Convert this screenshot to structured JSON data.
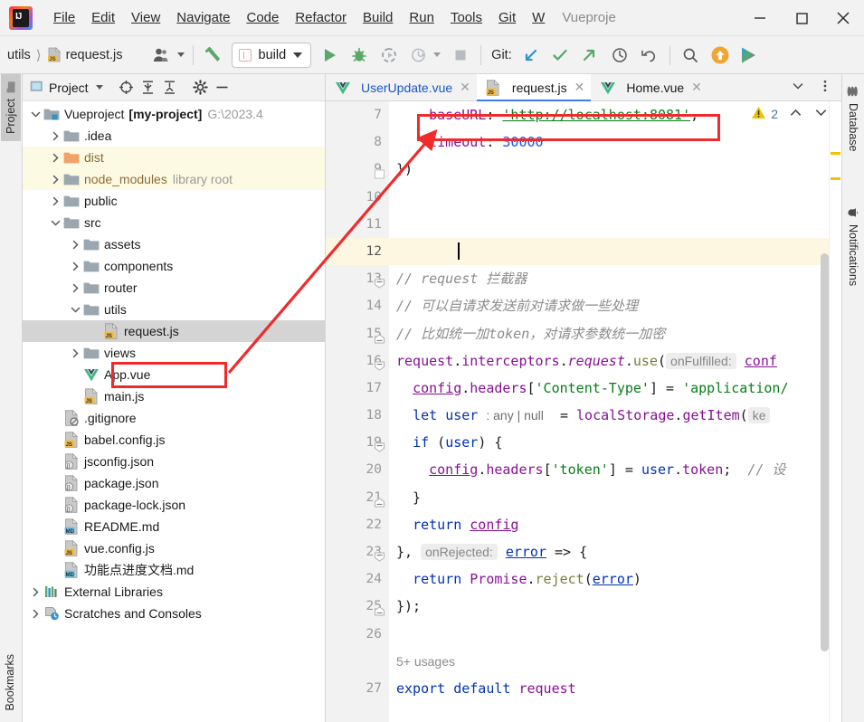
{
  "window": {
    "title": "Vueproje",
    "app_icon": "intellij-idea-logo"
  },
  "menu": {
    "items": [
      {
        "label": "File",
        "mnemonic": "F"
      },
      {
        "label": "Edit",
        "mnemonic": "E"
      },
      {
        "label": "View",
        "mnemonic": "V"
      },
      {
        "label": "Navigate",
        "mnemonic": "N"
      },
      {
        "label": "Code",
        "mnemonic": "C"
      },
      {
        "label": "Refactor",
        "mnemonic": "R"
      },
      {
        "label": "Build",
        "mnemonic": "B"
      },
      {
        "label": "Run",
        "mnemonic": "u"
      },
      {
        "label": "Tools",
        "mnemonic": "T"
      },
      {
        "label": "Git",
        "mnemonic": "G"
      },
      {
        "label": "W",
        "mnemonic": "W"
      }
    ],
    "minimize": "minimize-window",
    "maximize": "maximize-window",
    "close": "close-window"
  },
  "toolbar": {
    "breadcrumb": [
      "utils",
      "request.js"
    ],
    "breadcrumb_file_icon": "js-file-icon",
    "avatar_label": "user-account",
    "build_hammer": "build-hammer-icon",
    "run_config": "build",
    "run": "run-button",
    "debug": "debug-button",
    "coverage": "run-with-coverage-button",
    "profiler": "profiler-button",
    "stop": "stop-button",
    "git_label": "Git:",
    "git_update": "git-update-project",
    "git_commit": "git-commit",
    "git_push": "git-push",
    "git_history": "git-history",
    "git_rollback": "git-rollback",
    "search": "search-everywhere",
    "update_app": "ide-update-available",
    "ide_run": "ide-extra-run"
  },
  "left_stripe": {
    "project": "Project",
    "bookmarks": "Bookmarks"
  },
  "right_stripe": {
    "database": "Database",
    "notifications": "Notifications"
  },
  "project_panel": {
    "title": "Project",
    "buttons": [
      "select-opened-file",
      "expand-all",
      "collapse-all",
      "settings",
      "hide"
    ],
    "tree": [
      {
        "indent": 0,
        "arrow": "down",
        "icon": "module-folder-icon",
        "label": "Vueproject",
        "bold": "[my-project]",
        "muted": "G:\\2023.4",
        "state": "normal"
      },
      {
        "indent": 1,
        "arrow": "right",
        "icon": "folder-icon",
        "label": ".idea",
        "state": "normal"
      },
      {
        "indent": 1,
        "arrow": "right",
        "icon": "excluded-folder-icon",
        "label": "dist",
        "state": "yellow"
      },
      {
        "indent": 1,
        "arrow": "right",
        "icon": "folder-icon",
        "label": "node_modules",
        "muted": "library root",
        "state": "yellow"
      },
      {
        "indent": 1,
        "arrow": "right",
        "icon": "folder-icon",
        "label": "public",
        "state": "normal"
      },
      {
        "indent": 1,
        "arrow": "down",
        "icon": "folder-icon",
        "label": "src",
        "state": "normal"
      },
      {
        "indent": 2,
        "arrow": "right",
        "icon": "folder-icon",
        "label": "assets",
        "state": "normal"
      },
      {
        "indent": 2,
        "arrow": "right",
        "icon": "folder-icon",
        "label": "components",
        "state": "normal"
      },
      {
        "indent": 2,
        "arrow": "right",
        "icon": "folder-icon",
        "label": "router",
        "state": "normal"
      },
      {
        "indent": 2,
        "arrow": "down",
        "icon": "folder-icon",
        "label": "utils",
        "state": "normal"
      },
      {
        "indent": 3,
        "arrow": "none",
        "icon": "js-file-icon",
        "label": "request.js",
        "state": "selected"
      },
      {
        "indent": 2,
        "arrow": "right",
        "icon": "folder-icon",
        "label": "views",
        "state": "normal"
      },
      {
        "indent": 2,
        "arrow": "none",
        "icon": "vue-file-icon",
        "label": "App.vue",
        "state": "normal"
      },
      {
        "indent": 2,
        "arrow": "none",
        "icon": "js-file-icon",
        "label": "main.js",
        "state": "normal"
      },
      {
        "indent": 1,
        "arrow": "none",
        "icon": "gitignore-file-icon",
        "label": ".gitignore",
        "state": "normal"
      },
      {
        "indent": 1,
        "arrow": "none",
        "icon": "js-file-icon",
        "label": "babel.config.js",
        "state": "normal"
      },
      {
        "indent": 1,
        "arrow": "none",
        "icon": "json-file-icon",
        "label": "jsconfig.json",
        "state": "normal"
      },
      {
        "indent": 1,
        "arrow": "none",
        "icon": "json-file-icon",
        "label": "package.json",
        "state": "normal"
      },
      {
        "indent": 1,
        "arrow": "none",
        "icon": "json-file-icon",
        "label": "package-lock.json",
        "state": "normal"
      },
      {
        "indent": 1,
        "arrow": "none",
        "icon": "md-file-icon",
        "label": "README.md",
        "state": "normal"
      },
      {
        "indent": 1,
        "arrow": "none",
        "icon": "js-file-icon",
        "label": "vue.config.js",
        "state": "normal"
      },
      {
        "indent": 1,
        "arrow": "none",
        "icon": "md-file-icon",
        "label": "功能点进度文档.md",
        "state": "normal"
      },
      {
        "indent": 0,
        "arrow": "right",
        "icon": "external-libraries-icon",
        "label": "External Libraries",
        "state": "normal"
      },
      {
        "indent": 0,
        "arrow": "right",
        "icon": "scratches-icon",
        "label": "Scratches and Consoles",
        "state": "normal"
      }
    ]
  },
  "editor": {
    "tabs": [
      {
        "label": "UserUpdate.vue",
        "icon": "vue-file-icon",
        "active": false,
        "color": "blue"
      },
      {
        "label": "request.js",
        "icon": "js-file-icon",
        "active": true,
        "color": "normal"
      },
      {
        "label": "Home.vue",
        "icon": "vue-file-icon",
        "active": false,
        "color": "normal"
      }
    ],
    "tab_list_button": "show-hidden-tabs",
    "tab_options_button": "tab-options",
    "inspection": {
      "icon": "warning-triangle-icon",
      "count": "2",
      "prev": "previous-highlight",
      "next": "next-highlight"
    },
    "first_line_number": 7,
    "caret_line": 12,
    "lines": [
      {
        "no": 7,
        "fold": "none",
        "cur": false,
        "tokens": [
          {
            "t": "    ",
            "c": "plain"
          },
          {
            "t": "baseURL",
            "c": "p"
          },
          {
            "t": ": ",
            "c": "plain"
          },
          {
            "t": "'http://localhost:8081'",
            "c": "s-u"
          },
          {
            "t": ",",
            "c": "plain"
          }
        ]
      },
      {
        "no": 8,
        "fold": "none",
        "cur": false,
        "tokens": [
          {
            "t": "    ",
            "c": "plain"
          },
          {
            "t": "timeout",
            "c": "p"
          },
          {
            "t": ": ",
            "c": "plain"
          },
          {
            "t": "30000",
            "c": "n"
          }
        ]
      },
      {
        "no": 9,
        "fold": "end",
        "cur": false,
        "tokens": [
          {
            "t": "})",
            "c": "plain"
          }
        ]
      },
      {
        "no": 10,
        "fold": "none",
        "cur": false,
        "tokens": []
      },
      {
        "no": 11,
        "fold": "none",
        "cur": false,
        "tokens": []
      },
      {
        "no": 12,
        "fold": "none",
        "cur": true,
        "tokens": [
          {
            "t": "caret",
            "c": "caret"
          }
        ]
      },
      {
        "no": 13,
        "fold": "open",
        "cur": false,
        "tokens": [
          {
            "t": "// request 拦截器",
            "c": "c"
          }
        ]
      },
      {
        "no": 14,
        "fold": "none",
        "cur": false,
        "tokens": [
          {
            "t": "// 可以自请求发送前对请求做一些处理",
            "c": "c"
          }
        ]
      },
      {
        "no": 15,
        "fold": "close",
        "cur": false,
        "tokens": [
          {
            "t": "// 比如统一加token，对请求参数统一加密",
            "c": "c"
          }
        ]
      },
      {
        "no": 16,
        "fold": "open",
        "cur": false,
        "tokens": [
          {
            "t": "request",
            "c": "p"
          },
          {
            "t": ".",
            "c": "plain"
          },
          {
            "t": "interceptors",
            "c": "p"
          },
          {
            "t": ".",
            "c": "plain"
          },
          {
            "t": "request",
            "c": "p-it"
          },
          {
            "t": ".",
            "c": "plain"
          },
          {
            "t": "use",
            "c": "m"
          },
          {
            "t": "(",
            "c": "plain"
          },
          {
            "t": "onFulfilled:",
            "c": "hint"
          },
          {
            "t": " ",
            "c": "plain"
          },
          {
            "t": "conf",
            "c": "p-u"
          }
        ]
      },
      {
        "no": 17,
        "fold": "none",
        "cur": false,
        "tokens": [
          {
            "t": "  ",
            "c": "plain"
          },
          {
            "t": "config",
            "c": "p-u"
          },
          {
            "t": ".",
            "c": "plain"
          },
          {
            "t": "headers",
            "c": "p"
          },
          {
            "t": "[",
            "c": "plain"
          },
          {
            "t": "'Content-Type'",
            "c": "s"
          },
          {
            "t": "] = ",
            "c": "plain"
          },
          {
            "t": "'application/",
            "c": "s"
          }
        ]
      },
      {
        "no": 18,
        "fold": "none",
        "cur": false,
        "tokens": [
          {
            "t": "  ",
            "c": "plain"
          },
          {
            "t": "let",
            "c": "k"
          },
          {
            "t": " ",
            "c": "plain"
          },
          {
            "t": "user",
            "c": "k"
          },
          {
            "t": " ",
            "c": "plain"
          },
          {
            "t": ": any | null",
            "c": "hint2"
          },
          {
            "t": "  = ",
            "c": "plain"
          },
          {
            "t": "localStorage",
            "c": "p"
          },
          {
            "t": ".",
            "c": "plain"
          },
          {
            "t": "getItem",
            "c": "p"
          },
          {
            "t": "(",
            "c": "plain"
          },
          {
            "t": "ke",
            "c": "hint"
          }
        ]
      },
      {
        "no": 19,
        "fold": "open",
        "cur": false,
        "tokens": [
          {
            "t": "  ",
            "c": "plain"
          },
          {
            "t": "if",
            "c": "k"
          },
          {
            "t": " (",
            "c": "plain"
          },
          {
            "t": "user",
            "c": "k"
          },
          {
            "t": ") {",
            "c": "plain"
          }
        ]
      },
      {
        "no": 20,
        "fold": "none",
        "cur": false,
        "tokens": [
          {
            "t": "    ",
            "c": "plain"
          },
          {
            "t": "config",
            "c": "p-u"
          },
          {
            "t": ".",
            "c": "plain"
          },
          {
            "t": "headers",
            "c": "p"
          },
          {
            "t": "[",
            "c": "plain"
          },
          {
            "t": "'token'",
            "c": "s"
          },
          {
            "t": "] = ",
            "c": "plain"
          },
          {
            "t": "user",
            "c": "k"
          },
          {
            "t": ".",
            "c": "plain"
          },
          {
            "t": "token",
            "c": "p"
          },
          {
            "t": ";  ",
            "c": "plain"
          },
          {
            "t": "// 设",
            "c": "c"
          }
        ]
      },
      {
        "no": 21,
        "fold": "close",
        "cur": false,
        "tokens": [
          {
            "t": "  }",
            "c": "plain"
          }
        ]
      },
      {
        "no": 22,
        "fold": "none",
        "cur": false,
        "tokens": [
          {
            "t": "  ",
            "c": "plain"
          },
          {
            "t": "return",
            "c": "k"
          },
          {
            "t": " ",
            "c": "plain"
          },
          {
            "t": "config",
            "c": "p-u"
          }
        ]
      },
      {
        "no": 23,
        "fold": "open",
        "cur": false,
        "tokens": [
          {
            "t": "}, ",
            "c": "plain"
          },
          {
            "t": "onRejected:",
            "c": "hint"
          },
          {
            "t": " ",
            "c": "plain"
          },
          {
            "t": "error",
            "c": "k-u"
          },
          {
            "t": " => {",
            "c": "plain"
          }
        ]
      },
      {
        "no": 24,
        "fold": "none",
        "cur": false,
        "tokens": [
          {
            "t": "  ",
            "c": "plain"
          },
          {
            "t": "return",
            "c": "k"
          },
          {
            "t": " ",
            "c": "plain"
          },
          {
            "t": "Promise",
            "c": "p"
          },
          {
            "t": ".",
            "c": "plain"
          },
          {
            "t": "reject",
            "c": "m"
          },
          {
            "t": "(",
            "c": "plain"
          },
          {
            "t": "error",
            "c": "k-u"
          },
          {
            "t": ")",
            "c": "plain"
          }
        ]
      },
      {
        "no": 25,
        "fold": "close",
        "cur": false,
        "tokens": [
          {
            "t": "});",
            "c": "plain"
          }
        ]
      },
      {
        "no": 26,
        "fold": "none",
        "cur": false,
        "tokens": []
      },
      {
        "no": "",
        "fold": "none",
        "cur": false,
        "tokens": [
          {
            "t": "5+ usages",
            "c": "usages"
          }
        ]
      },
      {
        "no": 27,
        "fold": "none",
        "cur": false,
        "tokens": [
          {
            "t": "export",
            "c": "k"
          },
          {
            "t": " ",
            "c": "plain"
          },
          {
            "t": "default",
            "c": "k"
          },
          {
            "t": " ",
            "c": "plain"
          },
          {
            "t": "request",
            "c": "p"
          }
        ]
      }
    ]
  },
  "annotations": {
    "color": "#ef2b2b",
    "boxes": [
      "baseURL-line-highlight",
      "request-js-tree-node-highlight"
    ],
    "arrow": "arrow-from-baseURL-to-request-js"
  },
  "colors": {
    "accent_blue": "#3f7ee8",
    "string_green": "#067d17",
    "identifier_purple": "#871094",
    "keyword_blue": "#0033b3",
    "comment_gray": "#8c8c8c",
    "annotation_red": "#ef2b2b",
    "warning_yellow": "#f0c200"
  }
}
